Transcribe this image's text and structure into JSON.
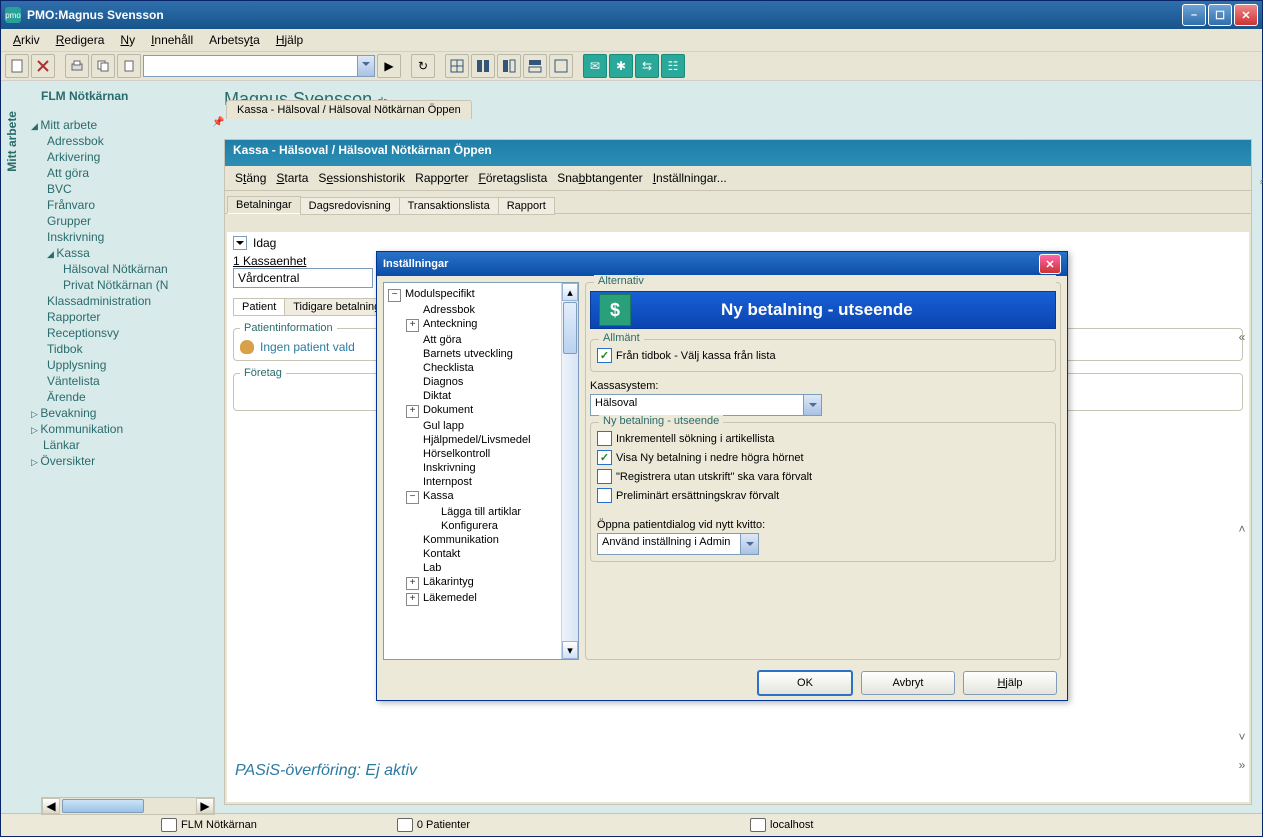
{
  "title": "PMO:Magnus Svensson",
  "menubar": [
    "Arkiv",
    "Redigera",
    "Ny",
    "Innehåll",
    "Arbetsyta",
    "Hjälp"
  ],
  "sidebar_title": "FLM Nötkärnan",
  "vside": "Mitt arbete",
  "tree": {
    "root": "Mitt arbete",
    "items": [
      "Adressbok",
      "Arkivering",
      "Att göra",
      "BVC",
      "Frånvaro",
      "Grupper",
      "Inskrivning"
    ],
    "kassa": "Kassa",
    "kassa_children": [
      "Hälsoval Nötkärnan",
      "Privat Nötkärnan (N"
    ],
    "after": [
      "Klassadministration",
      "Rapporter",
      "Receptionsvy",
      "Tidbok",
      "Upplysning",
      "Väntelista",
      "Ärende"
    ],
    "groups": [
      "Bevakning",
      "Kommunikation",
      "Länkar",
      "Översikter"
    ]
  },
  "main_title": "Magnus Svensson",
  "main_title_suffix": "dr",
  "tab_main": "Kassa - Hälsoval / Hälsoval Nötkärnan Öppen",
  "subheader": "Kassa - Hälsoval / Hälsoval Nötkärnan Öppen",
  "submenu": [
    "Stäng",
    "Starta",
    "Sessionshistorik",
    "Rapporter",
    "Företagslista",
    "Snabbtangenter",
    "Inställningar..."
  ],
  "subtabs": [
    "Betalningar",
    "Dagsredovisning",
    "Transaktionslista",
    "Rapport"
  ],
  "idag": "Idag",
  "kassaenhet_label": "1 Kassaenhet",
  "kassaenhet_value": "Vårdcentral",
  "ptabs": [
    "Patient",
    "Tidigare betalningar"
  ],
  "patientinfo": "Patientinformation",
  "no_patient": "Ingen patient vald",
  "foretag": "Företag",
  "footer": "PASiS-överföring: Ej aktiv",
  "status": {
    "org": "FLM Nötkärnan",
    "pat": "0 Patienter",
    "host": "localhost"
  },
  "modal": {
    "title": "Inställningar",
    "tree": {
      "root": "Modulspecifikt",
      "items": [
        "Adressbok",
        "Anteckning",
        "Att göra",
        "Barnets utveckling",
        "Checklista",
        "Diagnos",
        "Diktat",
        "Dokument",
        "Gul lapp",
        "Hjälpmedel/Livsmedel",
        "Hörselkontroll",
        "Inskrivning",
        "Internpost",
        "Kassa",
        "Kommunikation",
        "Kontakt",
        "Lab",
        "Läkarintyg",
        "Läkemedel"
      ],
      "expandable": {
        "1": true,
        "7": true,
        "13": true,
        "17": true,
        "18": true
      },
      "kassa_children": [
        "Lägga till artiklar",
        "Konfigurera"
      ]
    },
    "right_title": "Alternativ",
    "banner": "Ny betalning - utseende",
    "grp_allmant": "Allmänt",
    "chk_tidbok": "Från tidbok - Välj kassa från lista",
    "kassasystem_label": "Kassasystem:",
    "kassasystem_value": "Hälsoval",
    "grp_ny": "Ny betalning - utseende",
    "chk_rows": [
      {
        "label": "Inkrementell sökning i artikellista",
        "checked": false
      },
      {
        "label": "Visa Ny betalning i nedre högra hörnet",
        "checked": true
      },
      {
        "label": "\"Registrera utan utskrift\" ska vara förvalt",
        "checked": false
      },
      {
        "label": "Preliminärt ersättningskrav förvalt",
        "checked": false
      }
    ],
    "dialog_label": "Öppna patientdialog vid nytt kvitto:",
    "dialog_value": "Använd inställning i Admin",
    "ok": "OK",
    "cancel": "Avbryt",
    "help": "Hjälp"
  }
}
